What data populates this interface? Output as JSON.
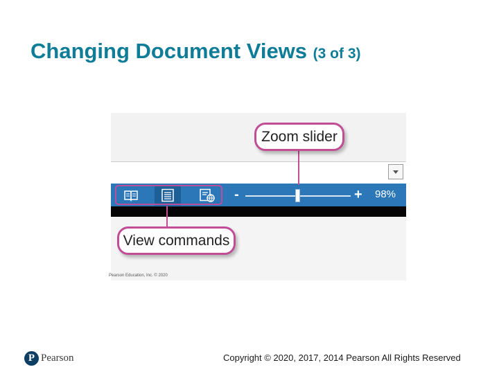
{
  "slide": {
    "title": "Changing Document Views",
    "subtitle": "(3 of 3)"
  },
  "figure": {
    "callout_zoom": "Zoom slider",
    "callout_view": "View commands",
    "credit": "Pearson Education, Inc. © 2020",
    "statusbar": {
      "color": "#2b77b8",
      "zoom_minus": "-",
      "zoom_plus": "+",
      "zoom_level": "98%",
      "zoom_value_percent": 98,
      "view_buttons": [
        {
          "name": "read-mode",
          "icon": "open-book-icon",
          "active": false
        },
        {
          "name": "print-layout",
          "icon": "page-lines-icon",
          "active": true
        },
        {
          "name": "web-layout",
          "icon": "globe-page-icon",
          "active": false
        }
      ]
    }
  },
  "footer": {
    "logo_mark": "P",
    "logo_text": "Pearson",
    "copyright": "Copyright © 2020, 2017, 2014 Pearson All Rights Reserved"
  },
  "colors": {
    "title": "#0f7c98",
    "callout_border": "#c14d96",
    "logo": "#0c3f63"
  }
}
